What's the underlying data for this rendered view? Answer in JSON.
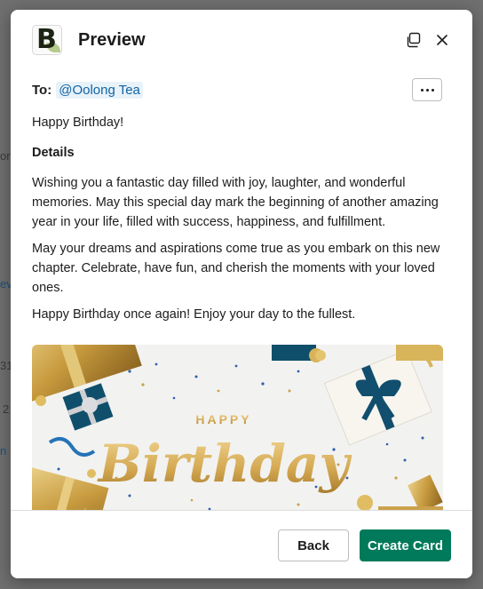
{
  "background": {
    "fragments": [
      "on",
      "ev",
      "31",
      "2",
      "n L"
    ]
  },
  "modal": {
    "title": "Preview",
    "app_logo_letter": "B",
    "icons": {
      "copy": "copy-icon",
      "close": "close-icon",
      "more": "more-horizontal-icon"
    }
  },
  "message": {
    "to_label": "To:",
    "recipient": "@Oolong Tea",
    "greeting": "Happy Birthday!",
    "details_heading": "Details",
    "paragraphs": [
      "Wishing you a fantastic day filled with joy, laughter, and wonderful memories. May this special day mark the beginning of another amazing year in your life, filled with success, happiness, and fulfillment.",
      "May your dreams and aspirations come true as you embark on this new chapter. Celebrate, have fun, and cherish the moments with your loved ones.",
      "Happy Birthday once again! Enjoy your day to the fullest."
    ],
    "image": {
      "top_text": "HAPPY",
      "main_text": "Birthday"
    }
  },
  "footer": {
    "back_label": "Back",
    "create_label": "Create Card"
  },
  "colors": {
    "primary": "#007a5a",
    "mention_bg": "#e8f2f9",
    "mention_text": "#1264a3"
  }
}
